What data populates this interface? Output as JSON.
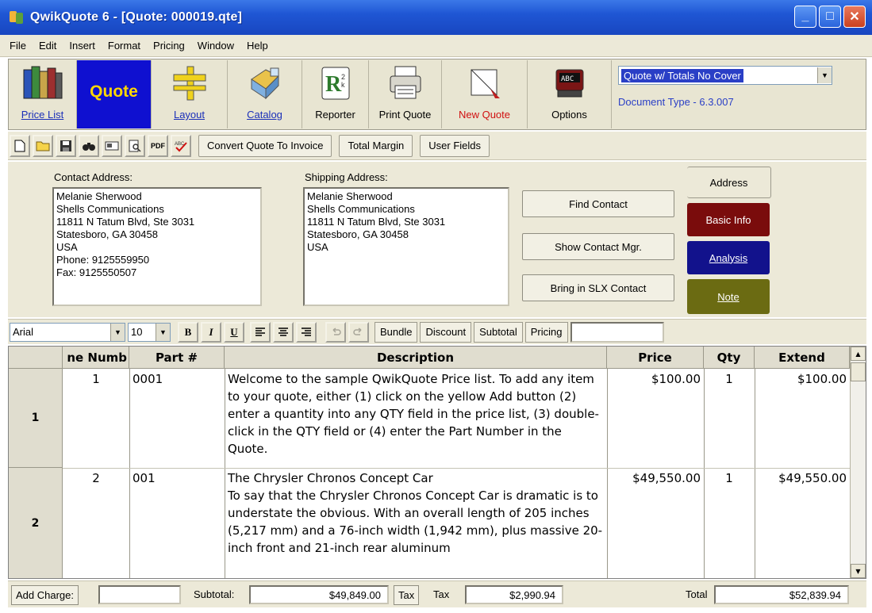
{
  "window": {
    "title": "QwikQuote 6 - [Quote: 000019.qte]"
  },
  "menu": [
    "File",
    "Edit",
    "Insert",
    "Format",
    "Pricing",
    "Window",
    "Help"
  ],
  "toolbar": {
    "price_list": "Price List",
    "quote": "Quote",
    "layout": "Layout",
    "catalog": "Catalog",
    "reporter": "Reporter",
    "print_quote": "Print Quote",
    "new_quote": "New Quote",
    "options": "Options",
    "doctype_value": "Quote w/ Totals No Cover",
    "doctype_label": "Document Type - 6.3.007"
  },
  "smalltoolbar": {
    "pdf_label": "PDF",
    "convert": "Convert Quote To Invoice",
    "total_margin": "Total Margin",
    "user_fields": "User Fields"
  },
  "address": {
    "contact_title": "Contact Address:",
    "contact_text": "Melanie Sherwood\nShells Communications\n11811 N Tatum Blvd, Ste 3031\nStatesboro, GA 30458\nUSA\nPhone: 9125559950\nFax: 9125550507",
    "shipping_title": "Shipping Address:",
    "shipping_text": "Melanie Sherwood\nShells Communications\n11811 N Tatum Blvd, Ste 3031\nStatesboro, GA 30458\nUSA",
    "find_contact": "Find Contact",
    "show_contact": "Show Contact Mgr.",
    "bring_slx": "Bring in SLX Contact",
    "tabs": [
      "Address",
      "Basic Info",
      "Analysis",
      "Note"
    ]
  },
  "format": {
    "font": "Arial",
    "size": "10",
    "bold": "B",
    "italic": "I",
    "underline": "U",
    "bundle": "Bundle",
    "discount": "Discount",
    "subtotal": "Subtotal",
    "pricing": "Pricing"
  },
  "grid": {
    "columns": [
      "ne Numb",
      "Part #",
      "Description",
      "Price",
      "Qty",
      "Extend"
    ],
    "rows": [
      {
        "row_label": "1",
        "line": "1",
        "part": "0001",
        "description": "Welcome to the sample QwikQuote Price list.  To add any item to your quote, either (1) click on the yellow Add button (2) enter a quantity into any QTY field in the price list, (3) double-click in the QTY field or (4) enter the Part Number in the Quote.",
        "price": "$100.00",
        "qty": "1",
        "extend": "$100.00"
      },
      {
        "row_label": "2",
        "line": "2",
        "part": "001",
        "description": "The Chrysler Chronos Concept Car\nTo say that the Chrysler Chronos Concept Car is dramatic is to understate the obvious. With an overall length of 205 inches (5,217 mm) and a 76-inch width (1,942 mm), plus massive 20-inch front and 21-inch rear aluminum",
        "price": "$49,550.00",
        "qty": "1",
        "extend": "$49,550.00"
      }
    ]
  },
  "status": {
    "add_charge": "Add Charge:",
    "subtotal_label": "Subtotal:",
    "subtotal_value": "$49,849.00",
    "tax_button": "Tax",
    "tax_label": "Tax",
    "tax_value": "$2,990.94",
    "total_label": "Total",
    "total_value": "$52,839.94"
  },
  "colors": {
    "titlebar": "#1f56d4",
    "quote_tab_bg": "#0f10d0",
    "quote_tab_text": "#ffd700",
    "basic_info_tab": "#7a0c0c",
    "analysis_tab": "#12128c",
    "note_tab": "#6b6b12"
  }
}
